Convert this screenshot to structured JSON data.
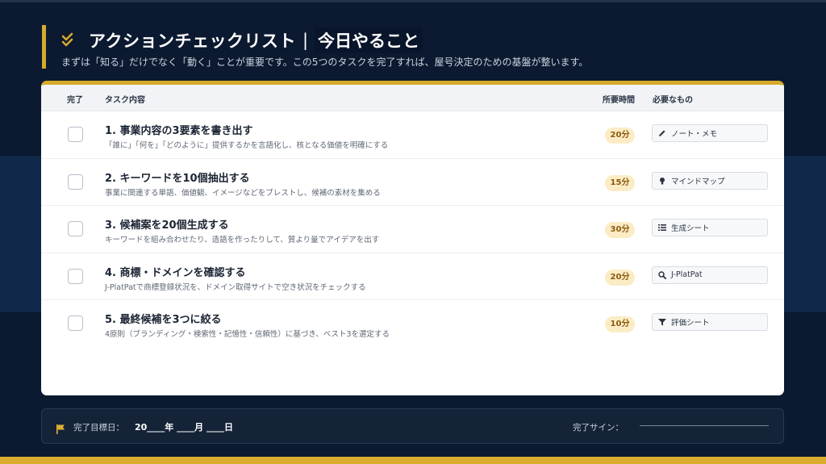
{
  "header": {
    "title_main": "アクションチェックリスト",
    "title_separator": "|",
    "title_accent": "今日やること",
    "subtitle": "まずは「知る」だけでなく「動く」ことが重要です。この5つのタスクを完了すれば、屋号決定のための基盤が整います。",
    "icon": "double-check-icon"
  },
  "table": {
    "headers": {
      "done": "完了",
      "task": "タスク内容",
      "time": "所要時間",
      "need": "必要なもの"
    },
    "rows": [
      {
        "title": "1. 事業内容の3要素を書き出す",
        "desc": "「誰に」「何を」「どのように」提供するかを言語化し、核となる価値を明確にする",
        "time": "20分",
        "need": "ノート・メモ",
        "icon": "pencil-icon",
        "checked": false
      },
      {
        "title": "2. キーワードを10個抽出する",
        "desc": "事業に関連する単語、価値観、イメージなどをブレストし、候補の素材を集める",
        "time": "15分",
        "need": "マインドマップ",
        "icon": "lightbulb-icon",
        "checked": false
      },
      {
        "title": "3. 候補案を20個生成する",
        "desc": "キーワードを組み合わせたり、造語を作ったりして、質より量でアイデアを出す",
        "time": "30分",
        "need": "生成シート",
        "icon": "list-icon",
        "checked": false
      },
      {
        "title": "4. 商標・ドメインを確認する",
        "desc": "J-PlatPatで商標登録状況を、ドメイン取得サイトで空き状況をチェックする",
        "time": "20分",
        "need": "J-PlatPat",
        "icon": "search-icon",
        "checked": false
      },
      {
        "title": "5. 最終候補を3つに絞る",
        "desc": "4原則（ブランディング・検索性・記憶性・信頼性）に基づき、ベスト3を選定する",
        "time": "10分",
        "need": "評価シート",
        "icon": "filter-icon",
        "checked": false
      }
    ]
  },
  "footer": {
    "target_label": "完了目標日：",
    "target_date": "20____年 ____月 ____日",
    "sign_label": "完了サイン：",
    "icon": "flag-icon"
  },
  "colors": {
    "accent": "#d7a92c",
    "background": "#0b1a30",
    "badge_bg": "#fbecc6",
    "badge_text": "#8b5a0c"
  }
}
